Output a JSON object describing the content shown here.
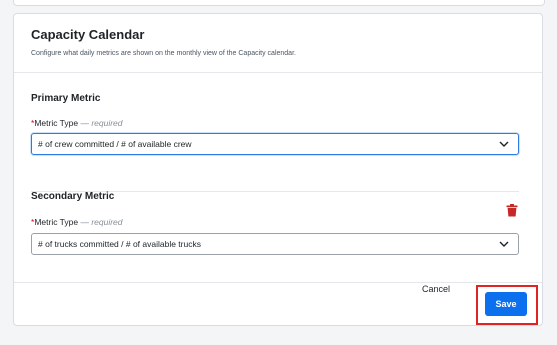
{
  "card": {
    "title": "Capacity Calendar",
    "subtitle": "Configure what daily metrics are shown on the monthly view of the Capacity calendar."
  },
  "primary": {
    "heading": "Primary Metric",
    "label": "Metric Type",
    "required_text": "— required",
    "value": "# of crew committed / # of available crew"
  },
  "secondary": {
    "heading": "Secondary Metric",
    "label": "Metric Type",
    "required_text": "— required",
    "value": "# of trucks committed / # of available trucks"
  },
  "footer": {
    "cancel_label": "Cancel",
    "save_label": "Save"
  },
  "icons": {
    "chevron": "chevron-down-icon",
    "delete": "trash-icon"
  },
  "colors": {
    "primary_button": "#0b6fee",
    "danger": "#c62828",
    "highlight_outline": "#e02424",
    "focus_border": "#2c7be5"
  }
}
